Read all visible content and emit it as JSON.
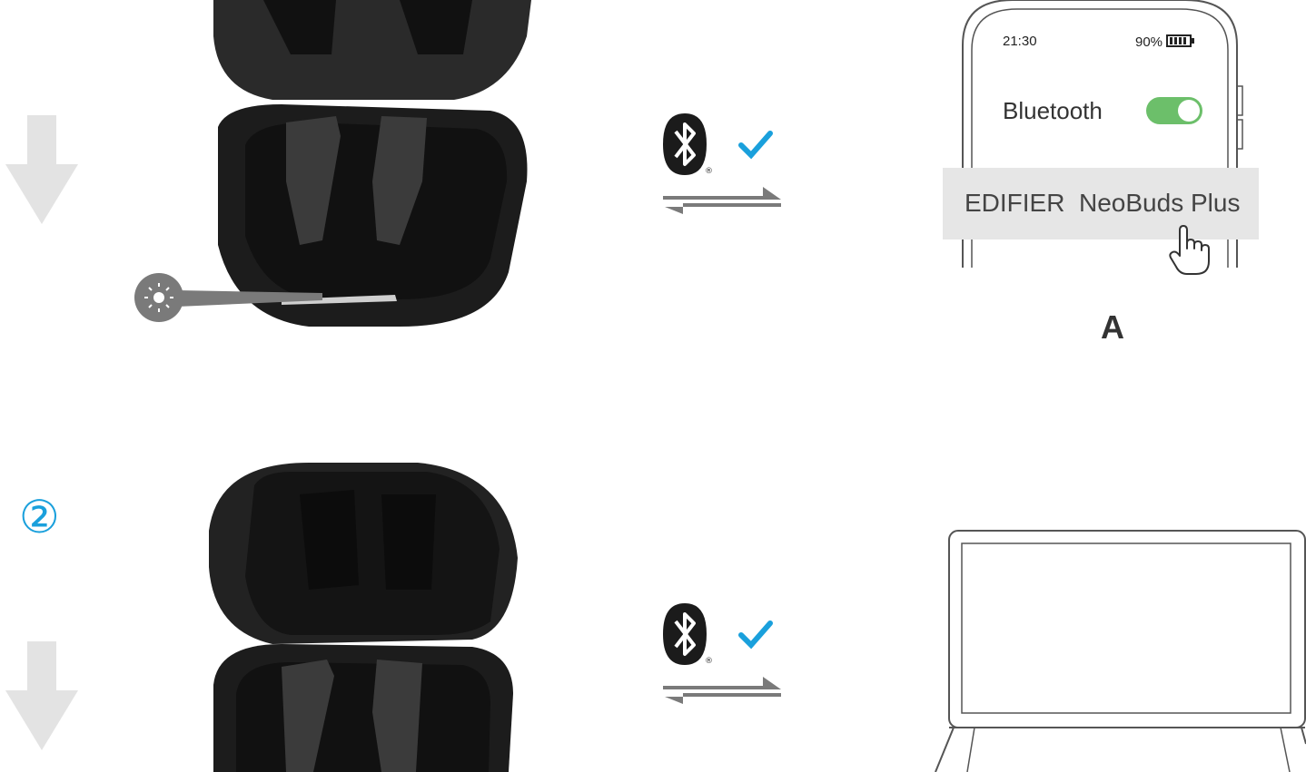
{
  "phone": {
    "time": "21:30",
    "battery": "90%",
    "bluetooth_label": "Bluetooth",
    "bluetooth_enabled": true,
    "device_name": "EDIFIER  NeoBuds Plus"
  },
  "labels": {
    "scenario_a": "A",
    "step_two": "②"
  },
  "icons": {
    "arrow": "arrow-down-icon",
    "bluetooth": "bluetooth-icon",
    "check": "check-icon",
    "swap": "swap-arrows-icon",
    "pointer": "hand-pointer-icon",
    "led": "led-light-icon"
  },
  "colors": {
    "check": "#1aa0dc",
    "toggle_on": "#6cbf6a",
    "step_number": "#1aa0dc",
    "arrow": "#e3e3e3"
  }
}
